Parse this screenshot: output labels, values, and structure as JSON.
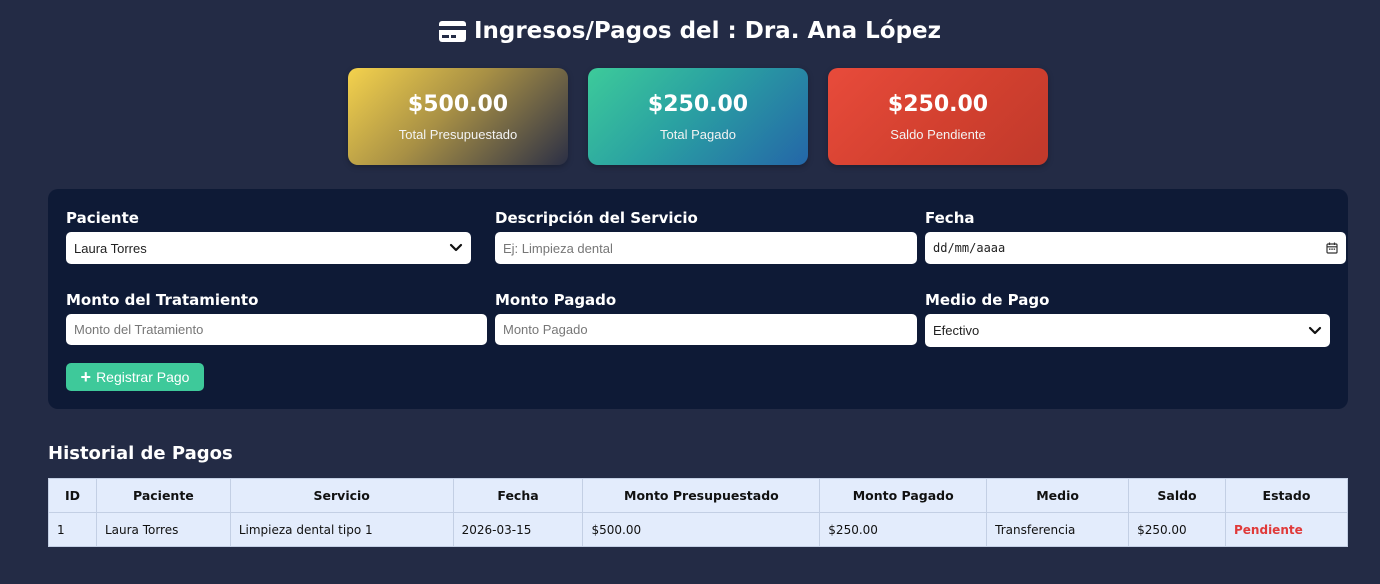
{
  "header": {
    "icon": "credit-card-icon",
    "title": "Ingresos/Pagos del : Dra. Ana López"
  },
  "summary": {
    "budgeted": {
      "amount": "$500.00",
      "label": "Total Presupuestado"
    },
    "paid": {
      "amount": "$250.00",
      "label": "Total Pagado"
    },
    "pending": {
      "amount": "$250.00",
      "label": "Saldo Pendiente"
    }
  },
  "form": {
    "patient": {
      "label": "Paciente",
      "value": "Laura Torres"
    },
    "service": {
      "label": "Descripción del Servicio",
      "placeholder": "Ej: Limpieza dental"
    },
    "date": {
      "label": "Fecha",
      "placeholder": "dd/mm/aaaa"
    },
    "treatment_amount": {
      "label": "Monto del Tratamiento",
      "placeholder": "Monto del Tratamiento"
    },
    "paid_amount": {
      "label": "Monto Pagado",
      "placeholder": "Monto Pagado"
    },
    "payment_method": {
      "label": "Medio de Pago",
      "value": "Efectivo"
    },
    "submit_label": "Registrar Pago"
  },
  "history": {
    "title": "Historial de Pagos",
    "columns": [
      "ID",
      "Paciente",
      "Servicio",
      "Fecha",
      "Monto Presupuestado",
      "Monto Pagado",
      "Medio",
      "Saldo",
      "Estado"
    ],
    "rows": [
      {
        "id": "1",
        "patient": "Laura Torres",
        "service": "Limpieza dental tipo 1",
        "date": "2026-03-15",
        "budgeted": "$500.00",
        "paid": "$250.00",
        "method": "Transferencia",
        "balance": "$250.00",
        "status": "Pendiente"
      }
    ]
  },
  "colors": {
    "background": "#232b45",
    "panel": "#0e1a36",
    "accent_green": "#3ec99a",
    "status_pending": "#e03a3a"
  }
}
